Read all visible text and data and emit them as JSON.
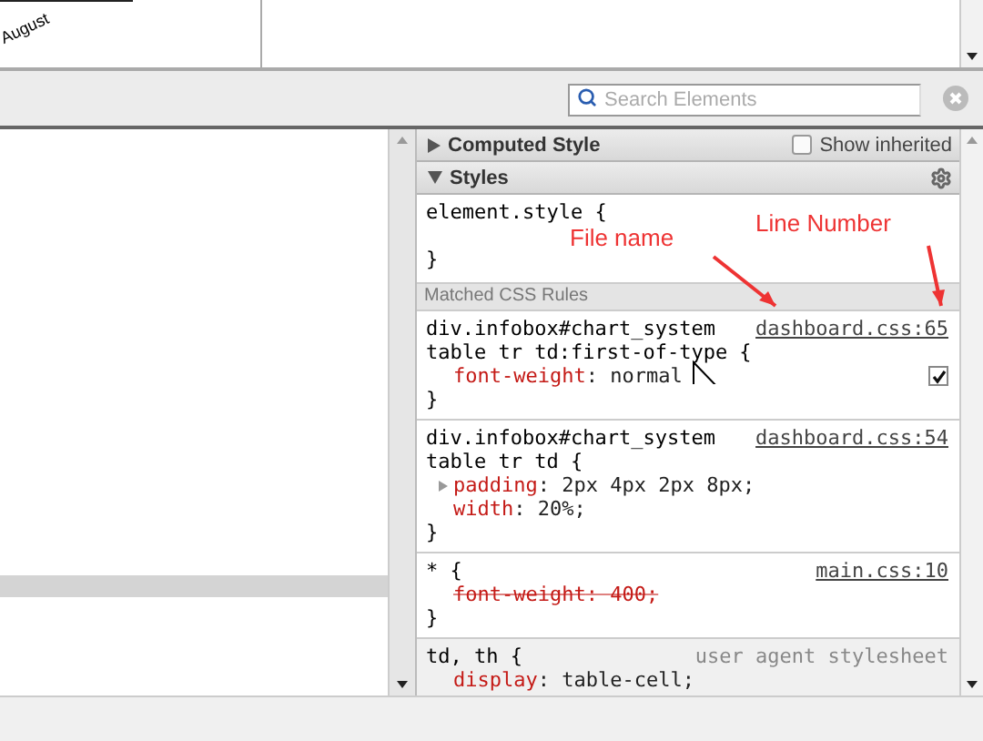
{
  "page_preview": {
    "axis_label": "August"
  },
  "toolbar": {
    "search": {
      "placeholder": "Search Elements"
    }
  },
  "sidebar": {
    "computed_style": {
      "title": "Computed Style",
      "expanded": false,
      "show_inherited": {
        "label": "Show inherited",
        "checked": false
      }
    },
    "styles": {
      "title": "Styles",
      "expanded": true,
      "element_style": {
        "selector": "element.style {",
        "close": "}"
      },
      "matched_header": "Matched CSS Rules",
      "rules": [
        {
          "kind": "author",
          "selector_lines": [
            "div.infobox#chart_system",
            "table tr td:first-of-type {"
          ],
          "source": "dashboard.css:65",
          "close": "}",
          "properties": [
            {
              "name": "font-weight",
              "sep": ":",
              "value": "normal",
              "overridden": false,
              "expandable": false,
              "checkbox": {
                "checked": true
              }
            }
          ]
        },
        {
          "kind": "author",
          "selector_lines": [
            "div.infobox#chart_system",
            "table tr td {"
          ],
          "source": "dashboard.css:54",
          "close": "}",
          "properties": [
            {
              "name": "padding",
              "sep": ":",
              "value": "2px 4px 2px 8px;",
              "overridden": false,
              "expandable": true
            },
            {
              "name": "width",
              "sep": ":",
              "value": "20%;",
              "overridden": false,
              "expandable": false
            }
          ]
        },
        {
          "kind": "author",
          "selector_lines": [
            "* {"
          ],
          "source": "main.css:10",
          "close": "}",
          "properties": [
            {
              "name": "font-weight",
              "sep": ":",
              "value": "400;",
              "overridden": true,
              "expandable": false
            }
          ]
        },
        {
          "kind": "user_agent",
          "selector_lines": [
            "td, th {"
          ],
          "source": "user agent stylesheet",
          "properties": [
            {
              "name": "display",
              "sep": ":",
              "value": "table-cell;",
              "overridden": false,
              "expandable": false
            }
          ]
        }
      ]
    }
  },
  "annotations": [
    {
      "text": "File name"
    },
    {
      "text": "Line Number"
    }
  ]
}
